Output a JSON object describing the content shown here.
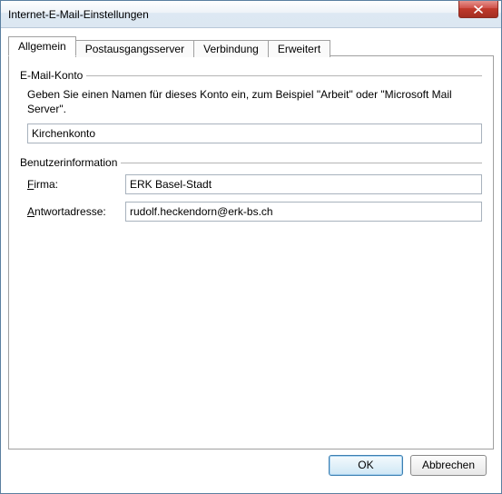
{
  "window": {
    "title": "Internet-E-Mail-Einstellungen"
  },
  "tabs": {
    "general": "Allgemein",
    "outgoing": "Postausgangsserver",
    "connection": "Verbindung",
    "advanced": "Erweitert"
  },
  "groups": {
    "account": {
      "title": "E-Mail-Konto",
      "description": "Geben Sie einen Namen für dieses Konto ein, zum Beispiel \"Arbeit\" oder \"Microsoft Mail Server\".",
      "value": "Kirchenkonto"
    },
    "userinfo": {
      "title": "Benutzerinformation",
      "company_label": "Firma:",
      "company_value": "ERK Basel-Stadt",
      "reply_label": "Antwortadresse:",
      "reply_value": "rudolf.heckendorn@erk-bs.ch"
    }
  },
  "buttons": {
    "ok": "OK",
    "cancel": "Abbrechen"
  }
}
